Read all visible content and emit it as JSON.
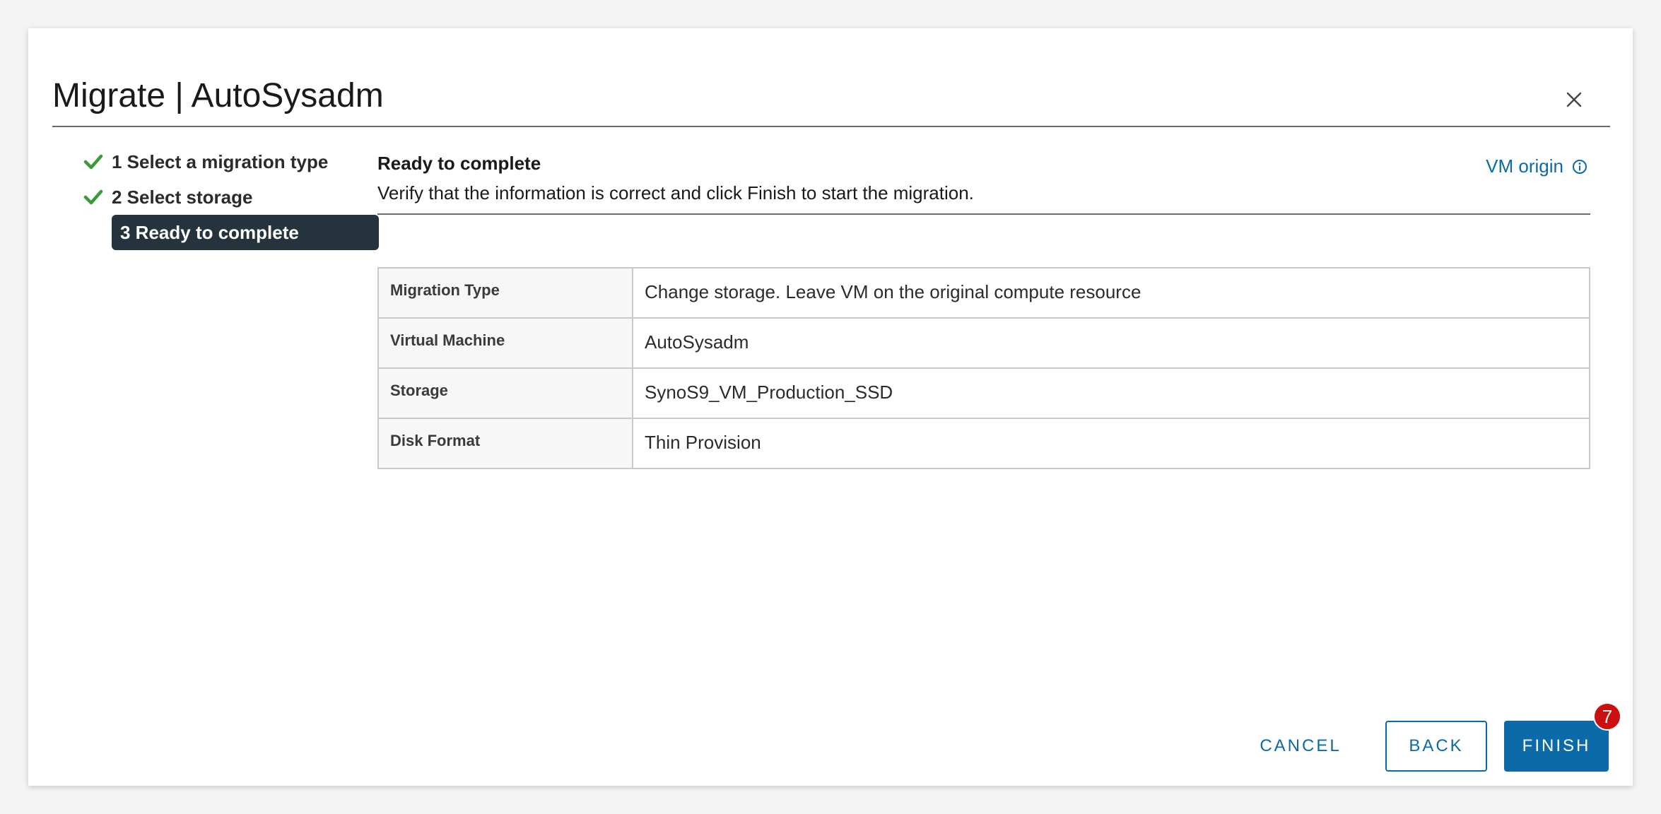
{
  "dialog": {
    "title": "Migrate | AutoSysadm",
    "close_icon": "close-icon"
  },
  "steps": [
    {
      "label": "1 Select a migration type",
      "status": "complete",
      "icon": "check-icon"
    },
    {
      "label": "2 Select storage",
      "status": "complete",
      "icon": "check-icon"
    },
    {
      "label": "3 Ready to complete",
      "status": "active"
    }
  ],
  "content": {
    "title": "Ready to complete",
    "description": "Verify that the information is correct and click Finish to start the migration.",
    "vm_origin_label": "VM origin",
    "vm_origin_icon": "info-icon"
  },
  "summary": {
    "rows": [
      {
        "key": "Migration Type",
        "value": "Change storage. Leave VM on the original compute resource"
      },
      {
        "key": "Virtual Machine",
        "value": "AutoSysadm"
      },
      {
        "key": "Storage",
        "value": "SynoS9_VM_Production_SSD"
      },
      {
        "key": "Disk Format",
        "value": "Thin Provision"
      }
    ]
  },
  "footer": {
    "cancel_label": "CANCEL",
    "back_label": "BACK",
    "finish_label": "FINISH",
    "finish_badge": "7"
  },
  "colors": {
    "accent": "#0b6aa8",
    "check": "#3a9a3a",
    "active_step_bg": "#25333d",
    "badge": "#cc1010"
  }
}
